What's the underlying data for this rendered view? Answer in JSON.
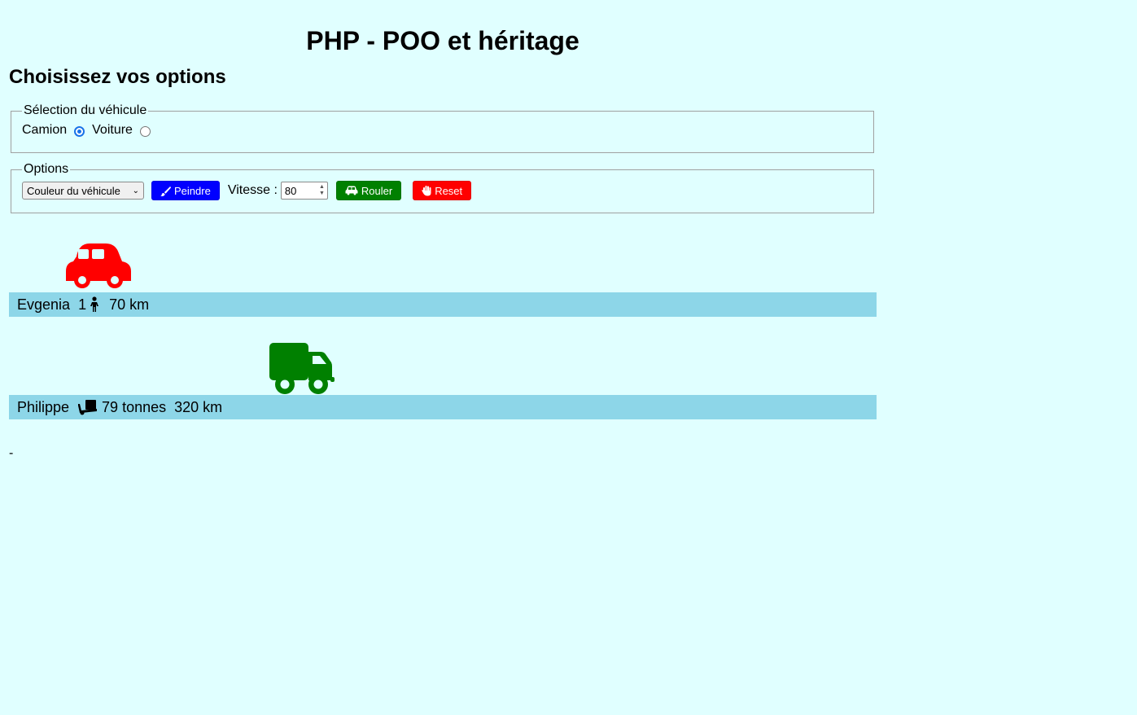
{
  "header": {
    "title": "PHP - POO et héritage",
    "subtitle": "Choisissez vos options"
  },
  "vehicle_selection": {
    "legend": "Sélection du véhicule",
    "options": [
      {
        "label": "Camion",
        "checked": true
      },
      {
        "label": "Voiture",
        "checked": false
      }
    ]
  },
  "options": {
    "legend": "Options",
    "color_select": {
      "selected": "Couleur du véhicule"
    },
    "paint_label": "Peindre",
    "speed_label": "Vitesse :",
    "speed_value": "80",
    "drive_label": "Rouler",
    "reset_label": "Reset"
  },
  "vehicles": [
    {
      "type": "car",
      "icon": "car-icon",
      "color": "#ff0000",
      "driver": "Evgenia",
      "passengers": "1",
      "distance": "70 km"
    },
    {
      "type": "truck",
      "icon": "truck-icon",
      "color": "#008000",
      "driver": "Philippe",
      "load": "79 tonnes",
      "distance": "320 km"
    }
  ],
  "footer": {
    "text": "-"
  },
  "colors": {
    "background": "#e0ffff",
    "track": "#8dd6e8",
    "paint": "#0000ff",
    "drive": "#008000",
    "reset": "#ff0000"
  }
}
